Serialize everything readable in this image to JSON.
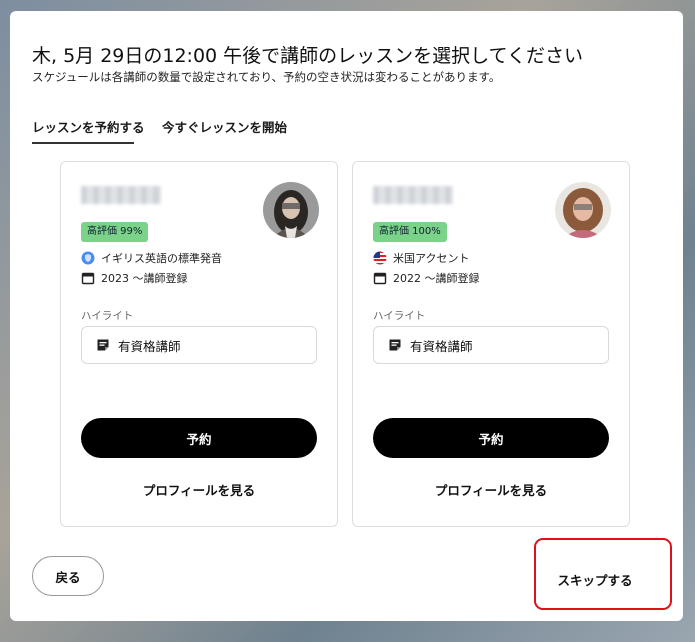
{
  "dialog": {
    "title": "木, 5月 29日の12:00 午後で講師のレッスンを選択してください",
    "subtitle": "スケジュールは各講師の数量で設定されており、予約の空き状況は変わることがあります。"
  },
  "tabs": [
    {
      "label": "レッスンを予約する",
      "active": true
    },
    {
      "label": "今すぐレッスンを開始",
      "active": false
    }
  ],
  "tutors": [
    {
      "name": "",
      "rating_badge": "高評価 99%",
      "accent_icon": "shield-icon",
      "accent": "イギリス英語の標準発音",
      "registered": "2023 〜講師登録",
      "highlight_label": "ハイライト",
      "highlight_item": "有資格講師",
      "book_label": "予約",
      "profile_label": "プロフィールを見る"
    },
    {
      "name": "",
      "rating_badge": "高評価 100%",
      "accent_icon": "us-flag-icon",
      "accent": "米国アクセント",
      "registered": "2022 〜講師登録",
      "highlight_label": "ハイライト",
      "highlight_item": "有資格講師",
      "book_label": "予約",
      "profile_label": "プロフィールを見る"
    }
  ],
  "footer": {
    "back_label": "戻る",
    "skip_label": "スキップする"
  },
  "colors": {
    "badge_green": "#7bd389",
    "primary_button": "#000000",
    "annotation_red": "#e0101a"
  }
}
